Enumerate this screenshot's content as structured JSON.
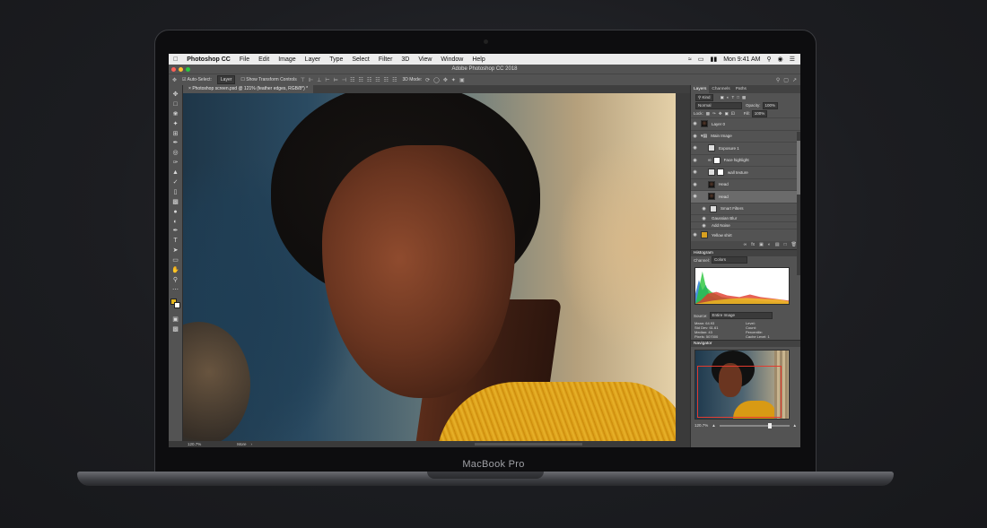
{
  "menubar": {
    "apple_icon": "apple-icon",
    "app": "Photoshop CC",
    "items": [
      "File",
      "Edit",
      "Image",
      "Layer",
      "Type",
      "Select",
      "Filter",
      "3D",
      "View",
      "Window",
      "Help"
    ],
    "clock": "Mon 9:41 AM"
  },
  "window": {
    "title": "Adobe Photoshop CC 2018",
    "traffic_colors": [
      "#ff5f57",
      "#febc2e",
      "#28c840"
    ]
  },
  "options": {
    "auto_select": "Auto-Select:",
    "layer": "Layer",
    "transform": "Show Transform Controls",
    "mode_3d": "3D Mode:"
  },
  "document": {
    "tab": "Photoshop screen.psd @ 121% (feather edges, RGB/8*) *"
  },
  "status": {
    "zoom": "120.7%",
    "more": "More"
  },
  "tools": {
    "fg_color": "#e3b51d",
    "bg_color": "#ffffff"
  },
  "layers_panel": {
    "tabs": [
      "Layers",
      "Channels",
      "Paths"
    ],
    "kind": "Kind",
    "blend": "Normal",
    "opacity_label": "Opacity:",
    "opacity_value": "100%",
    "lock_label": "Lock:",
    "fill_label": "Fill:",
    "fill_value": "100%",
    "layers": [
      {
        "name": "Layer 0"
      },
      {
        "name": "Main Image"
      },
      {
        "name": "Exposure 1"
      },
      {
        "name": "Face highlight"
      },
      {
        "name": "wall texture"
      },
      {
        "name": "Head"
      },
      {
        "name": "Head"
      },
      {
        "name": "Smart Filters"
      },
      {
        "name": "Gaussian Blur"
      },
      {
        "name": "Add Noise"
      },
      {
        "name": "Yellow shirt"
      }
    ]
  },
  "histogram": {
    "title": "Histogram",
    "channel_label": "Channel:",
    "channel_value": "Colors",
    "source_label": "Source:",
    "source_value": "Entire Image",
    "stats_left": [
      "Mean: 64.93",
      "Std Dev: 61.61",
      "Median: 43",
      "Pixels: 507000"
    ],
    "stats_right": [
      "Level:",
      "Count:",
      "Percentile:",
      "Cache Level: 1"
    ]
  },
  "navigator": {
    "title": "Navigator",
    "zoom": "120.7%"
  },
  "brand": "MacBook Pro"
}
